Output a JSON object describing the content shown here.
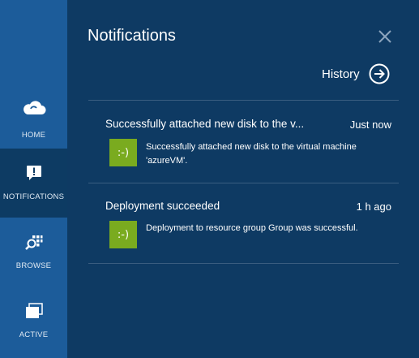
{
  "sidebar": {
    "items": [
      {
        "label": "HOME",
        "icon": "cloud-icon"
      },
      {
        "label": "NOTIFICATIONS",
        "icon": "notification-icon"
      },
      {
        "label": "BROWSE",
        "icon": "browse-icon"
      },
      {
        "label": "ACTIVE",
        "icon": "active-windows-icon"
      }
    ],
    "active_index": 1
  },
  "panel": {
    "title": "Notifications",
    "history_label": "History",
    "close_icon": "close-icon",
    "history_icon": "arrow-right-circle-icon"
  },
  "notifications": [
    {
      "title": "Successfully attached new disk to the v...",
      "time": "Just now",
      "badge": ":-)",
      "body": "Successfully attached new disk to the virtual machine 'azureVM'."
    },
    {
      "title": "Deployment succeeded",
      "time": "1 h ago",
      "badge": ":-)",
      "body": "Deployment to resource group Group was successful."
    }
  ],
  "colors": {
    "sidebar_bg": "#1c5c9a",
    "sidebar_active_bg": "#0d3b63",
    "panel_bg": "#0e3a63",
    "badge_bg": "#7aab1f",
    "divider": "#3a5d80"
  }
}
